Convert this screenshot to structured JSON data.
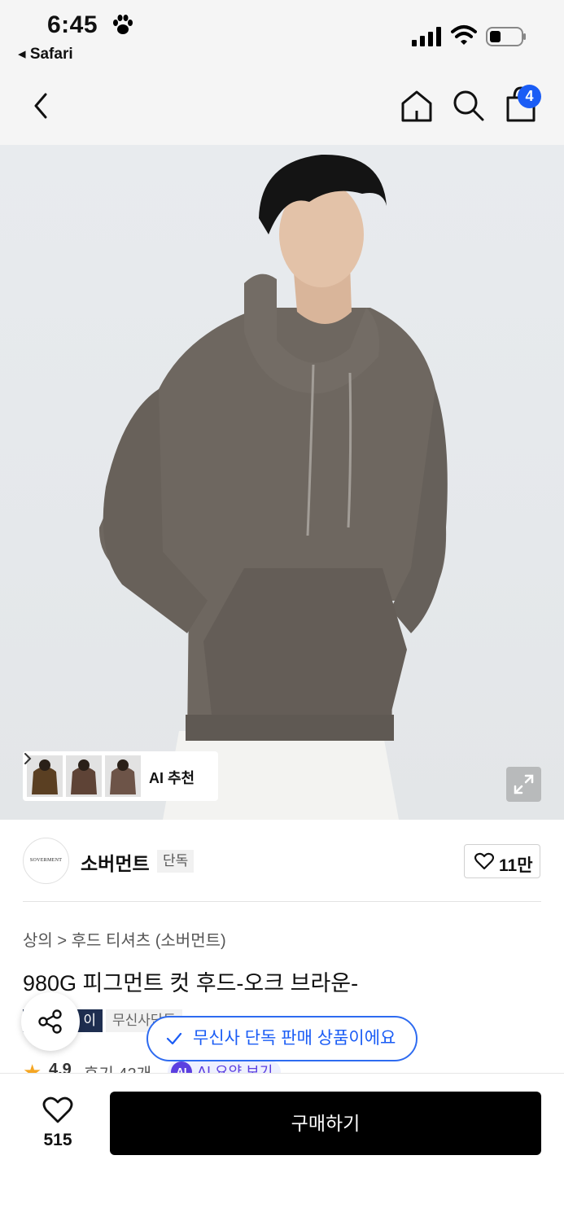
{
  "status_bar": {
    "time": "6:45",
    "back_app": "◂ Safari"
  },
  "nav": {
    "cart_count": "4"
  },
  "hero": {
    "ai_label": "AI 추천",
    "thumb_colors": [
      "#5a3f22",
      "#5e4336",
      "#6d5448"
    ],
    "hoodie_color": "#6e6760"
  },
  "brand": {
    "logo_text": "SOVERMENT",
    "name": "소버먼트",
    "tag": "단독",
    "likes": "11만"
  },
  "product": {
    "breadcrumb": [
      "상의",
      "후드 티셔츠 (소버먼트)"
    ],
    "breadcrumb_sep": ">",
    "title": "980G 피그먼트 컷 후드-오크 브라운-",
    "tag_dark": "이",
    "tag_light": "무신사단독"
  },
  "toast": {
    "text": "무신사 단독 판매 상품이에요"
  },
  "rating": {
    "star": "★",
    "score": "4.9",
    "reviews": "후기 42개",
    "ai_badge": "AI",
    "ai_summary": "AI 요약 보기"
  },
  "bottom": {
    "wish_count": "515",
    "buy_label": "구매하기"
  },
  "colors": {
    "accent": "#1a5cf5",
    "buy_button": "#000000",
    "tag_dark": "#1e2e50"
  }
}
